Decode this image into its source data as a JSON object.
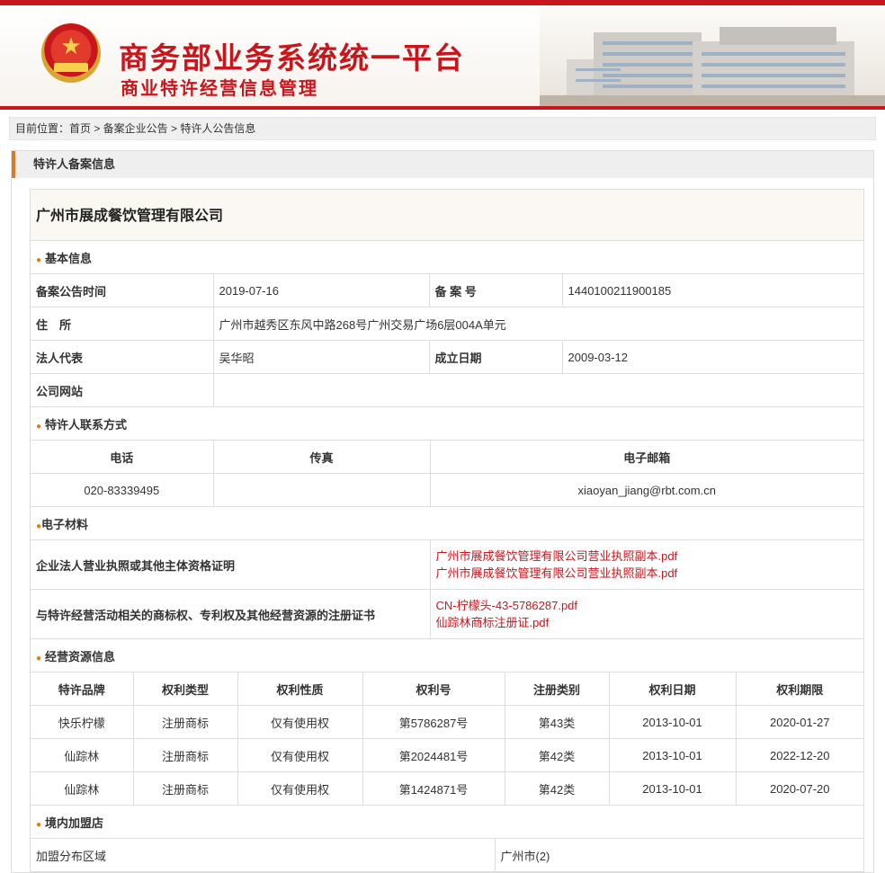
{
  "header": {
    "title": "商务部业务系统统一平台",
    "subtitle": "商业特许经营信息管理"
  },
  "breadcrumb": "目前位置：首页 > 备案企业公告 > 特许人公告信息",
  "panel_title": "特许人备案信息",
  "company_name": "广州市展成餐饮管理有限公司",
  "basic": {
    "section": "基本信息",
    "announce_date_label": "备案公告时间",
    "announce_date": "2019-07-16",
    "record_no_label": "备 案 号",
    "record_no": "1440100211900185",
    "address_label": "住　所",
    "address": "广州市越秀区东风中路268号广州交易广场6层004A单元",
    "legal_rep_label": "法人代表",
    "legal_rep": "吴华昭",
    "founded_label": "成立日期",
    "founded": "2009-03-12",
    "website_label": "公司网站",
    "website": ""
  },
  "contact": {
    "section": "特许人联系方式",
    "phone_label": "电话",
    "fax_label": "传真",
    "email_label": "电子邮箱",
    "phone": "020-83339495",
    "fax": "",
    "email": "xiaoyan_jiang@rbt.com.cn"
  },
  "materials": {
    "section": "电子材料",
    "row1_label": "企业法人营业执照或其他主体资格证明",
    "row1_files": [
      "广州市展成餐饮管理有限公司营业执照副本.pdf",
      "广州市展成餐饮管理有限公司营业执照副本.pdf"
    ],
    "row2_label": "与特许经营活动相关的商标权、专利权及其他经营资源的注册证书",
    "row2_files": [
      "CN-柠檬头-43-5786287.pdf",
      "仙踪林商标注册证.pdf"
    ]
  },
  "resources": {
    "section": "经营资源信息",
    "columns": [
      "特许品牌",
      "权利类型",
      "权利性质",
      "权利号",
      "注册类别",
      "权利日期",
      "权利期限"
    ],
    "rows": [
      [
        "快乐柠檬",
        "注册商标",
        "仅有使用权",
        "第5786287号",
        "第43类",
        "2013-10-01",
        "2020-01-27"
      ],
      [
        "仙踪林",
        "注册商标",
        "仅有使用权",
        "第2024481号",
        "第42类",
        "2013-10-01",
        "2022-12-20"
      ],
      [
        "仙踪林",
        "注册商标",
        "仅有使用权",
        "第1424871号",
        "第42类",
        "2013-10-01",
        "2020-07-20"
      ]
    ]
  },
  "stores": {
    "section": "境内加盟店",
    "region_label": "加盟分布区域",
    "region_value": "广州市(2)"
  },
  "colors": {
    "brand_red": "#c8161d",
    "accent_orange": "#e07d10",
    "link_red": "#c8161d"
  }
}
